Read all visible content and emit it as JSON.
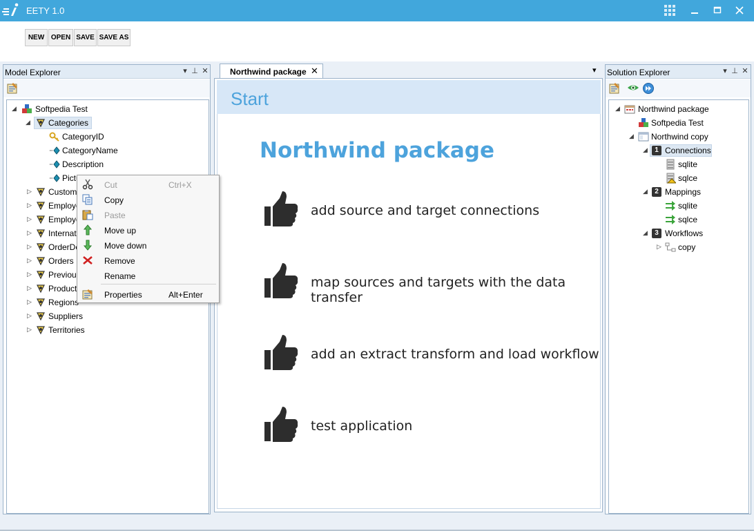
{
  "window": {
    "title": "EETY 1.0"
  },
  "toolbar": {
    "new": "NEW",
    "open": "OPEN",
    "save": "SAVE",
    "save_as": "SAVE AS"
  },
  "model_explorer": {
    "title": "Model Explorer",
    "root": "Softpedia Test",
    "categories": "Categories",
    "fields": [
      "CategoryID",
      "CategoryName",
      "Description",
      "Pictu"
    ],
    "tables": [
      "Custome",
      "Employe",
      "Employe",
      "Internat",
      "OrderDe",
      "Orders",
      "Previous",
      "Product",
      "Regions",
      "Suppliers",
      "Territories"
    ]
  },
  "document": {
    "tab_label": "Northwind package",
    "start_label": "Start",
    "heading": "Northwind package",
    "steps": [
      "add source and target connections",
      "map sources and targets with the data transfer",
      "add an extract transform and load workflow",
      "test application"
    ]
  },
  "solution_explorer": {
    "title": "Solution Explorer",
    "package": "Northwind package",
    "model": "Softpedia Test",
    "copy_node": "Northwind copy",
    "connections": {
      "index": "1",
      "label": "Connections",
      "items": [
        "sqlite",
        "sqlce"
      ]
    },
    "mappings": {
      "index": "2",
      "label": "Mappings",
      "items": [
        "sqlite",
        "sqlce"
      ]
    },
    "workflows": {
      "index": "3",
      "label": "Workflows",
      "items": [
        "copy"
      ]
    }
  },
  "context_menu": {
    "cut": "Cut",
    "cut_shortcut": "Ctrl+X",
    "copy": "Copy",
    "paste": "Paste",
    "move_up": "Move up",
    "move_down": "Move down",
    "remove": "Remove",
    "rename": "Rename",
    "properties": "Properties",
    "properties_shortcut": "Alt+Enter"
  },
  "colors": {
    "titlebar": "#41a7dc",
    "accent": "#4da3dc",
    "panel_header": "#e1ebf5"
  },
  "icons": [
    "app-logo-icon",
    "grid-icon",
    "minimize-icon",
    "maximize-icon",
    "close-icon",
    "pin-icon",
    "dropdown-icon",
    "properties-icon",
    "thumbs-up-icon",
    "database-icon",
    "table-icon",
    "key-icon",
    "column-icon",
    "mapping-icon",
    "workflow-icon",
    "eye-icon",
    "play-icon",
    "scissors-icon",
    "copy-icon",
    "paste-icon",
    "arrow-up-icon",
    "arrow-down-icon",
    "remove-icon"
  ]
}
